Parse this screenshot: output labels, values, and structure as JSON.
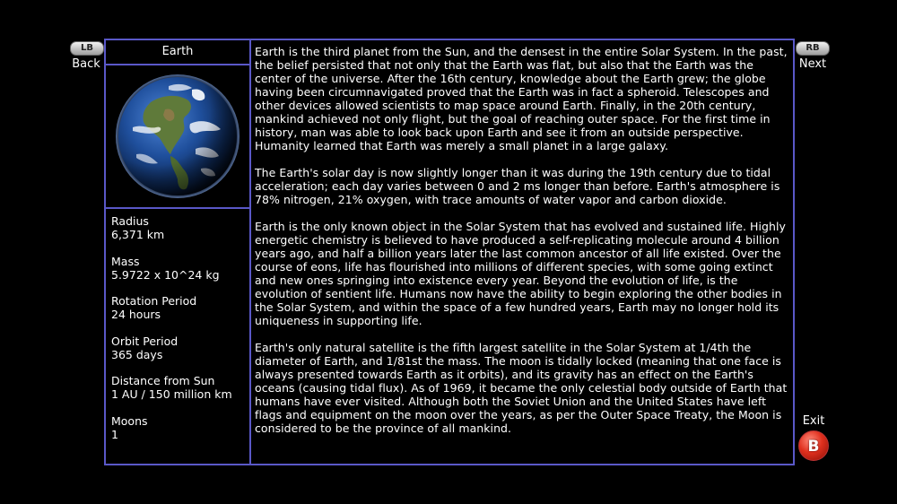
{
  "nav": {
    "lb_badge": "LB",
    "back_label": "Back",
    "rb_badge": "RB",
    "next_label": "Next",
    "exit_label": "Exit",
    "b_badge": "B"
  },
  "planet": {
    "name": "Earth",
    "image_icon": "earth-globe-image",
    "stats": [
      {
        "label": "Radius",
        "value": "6,371 km"
      },
      {
        "label": "Mass",
        "value": "5.9722 x 10^24 kg"
      },
      {
        "label": "Rotation Period",
        "value": "24 hours"
      },
      {
        "label": "Orbit Period",
        "value": "365 days"
      },
      {
        "label": "Distance from Sun",
        "value": "1 AU / 150 million km"
      },
      {
        "label": "Moons",
        "value": "1"
      }
    ],
    "description": [
      "Earth is the third planet from the Sun, and the densest in the entire Solar System. In the past, the belief persisted that not only that the Earth was flat, but also that the Earth was the center of the universe. After the 16th century, knowledge about the Earth grew; the globe having been circumnavigated proved that the Earth was in fact a spheroid. Telescopes and other devices allowed scientists to map space around Earth. Finally, in the 20th century, mankind achieved not only flight, but the goal of reaching outer space. For the first time in history, man was able to look back upon Earth and see it from an outside perspective. Humanity learned that Earth was merely a small planet in a large galaxy.",
      "The Earth's solar day is now slightly longer than it was during the 19th century due to tidal acceleration; each day varies between 0 and 2 ms longer than before. Earth's atmosphere is 78% nitrogen, 21% oxygen, with trace amounts of water vapor and carbon dioxide.",
      "Earth is the only known object in the Solar System that has evolved and sustained life. Highly energetic chemistry is believed to have produced a self-replicating molecule around 4 billion years ago, and half a billion years later the last common ancestor of all life existed. Over the course of eons, life has flourished into millions of different species, with some going extinct and new ones springing into existence every year. Beyond the evolution of life, is the evolution of sentient life. Humans now have the ability to begin exploring the other bodies in the Solar System, and within the space of a few hundred years, Earth may no longer hold its uniqueness in supporting life.",
      "Earth's only natural satellite is the fifth largest satellite in the Solar System at 1/4th the diameter of Earth, and 1/81st the mass. The moon is tidally locked (meaning that one face is always presented towards Earth as it orbits), and its gravity has an effect on the Earth's oceans (causing tidal flux). As of 1969, it became the only celestial body outside of Earth that humans have ever visited. Although both the Soviet Union and the United States have left flags and equipment on the moon over the years, as per the Outer Space Treaty, the Moon is considered to be the province of all mankind."
    ]
  },
  "colors": {
    "background": "#000000",
    "border": "#5a58c8",
    "text": "#ffffff",
    "exit_button": "#e0301e"
  }
}
